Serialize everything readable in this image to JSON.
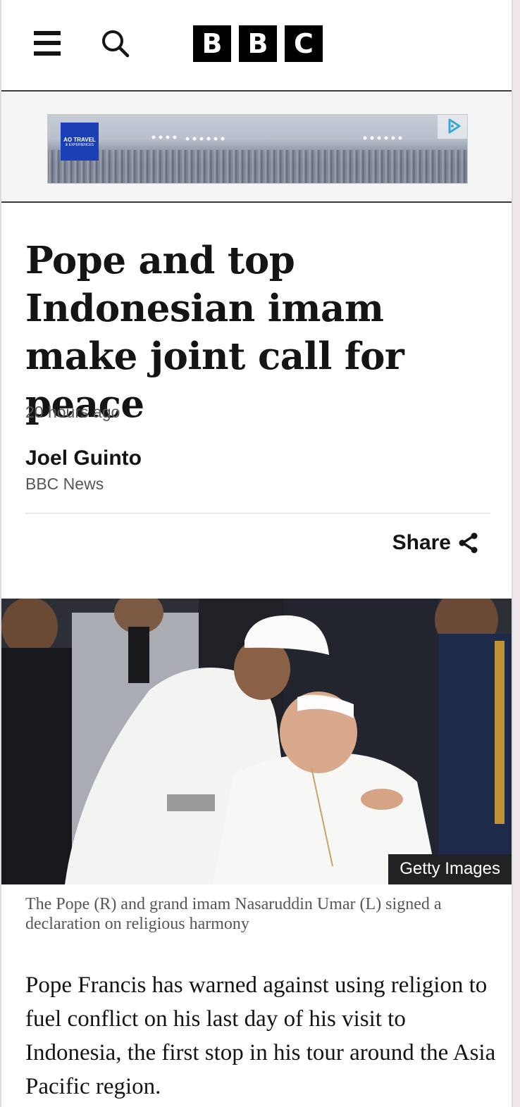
{
  "header": {
    "logo_letters": [
      "B",
      "B",
      "C"
    ]
  },
  "ad": {
    "brand_line1": "AO TRAVEL",
    "brand_line2": "& EXPERIENCES"
  },
  "article": {
    "headline": "Pope and top Indonesian imam make joint call for peace",
    "timestamp": "20 hours ago",
    "author": "Joel Guinto",
    "author_org": "BBC News",
    "share_label": "Share",
    "image_credit": "Getty Images",
    "caption": "The Pope (R) and grand imam Nasaruddin Umar (L) signed a declaration on religious harmony",
    "lead_paragraph": "Pope Francis has warned against using religion to fuel conflict on his last day of his visit to Indonesia, the first stop in his tour around the Asia Pacific region."
  },
  "icons": {
    "menu": "hamburger-icon",
    "search": "search-icon",
    "share": "share-icon",
    "ad_choices": "adchoices-icon"
  },
  "colors": {
    "text": "#141414",
    "muted": "#545658",
    "ad_logo": "#1b3fb4",
    "credit_bg": "#202224"
  }
}
